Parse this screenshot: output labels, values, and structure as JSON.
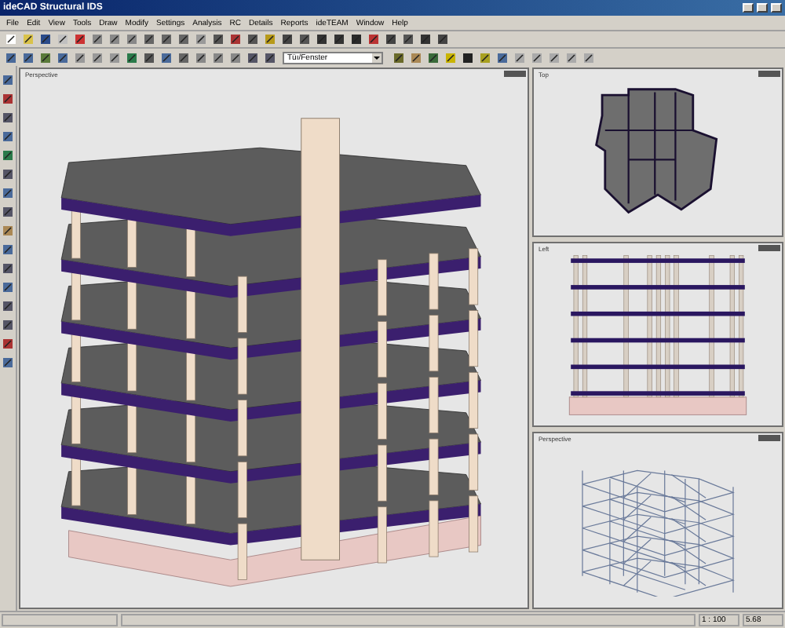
{
  "window": {
    "title": "ideCAD Structural IDS"
  },
  "menu": [
    "File",
    "Edit",
    "View",
    "Tools",
    "Draw",
    "Modify",
    "Settings",
    "Analysis",
    "RC",
    "Details",
    "Reports",
    "ideTEAM",
    "Window",
    "Help"
  ],
  "toolbar": {
    "layer_select": "Tüı/Fenster"
  },
  "viewports": [
    {
      "kind": "building",
      "label": "Perspective"
    },
    {
      "kind": "plan",
      "label": "Top"
    },
    {
      "kind": "elevation",
      "label": "Left"
    },
    {
      "kind": "wireframe",
      "label": "Perspective"
    }
  ],
  "status_bar": {
    "scale": "1 : 100",
    "value": "5.68"
  }
}
